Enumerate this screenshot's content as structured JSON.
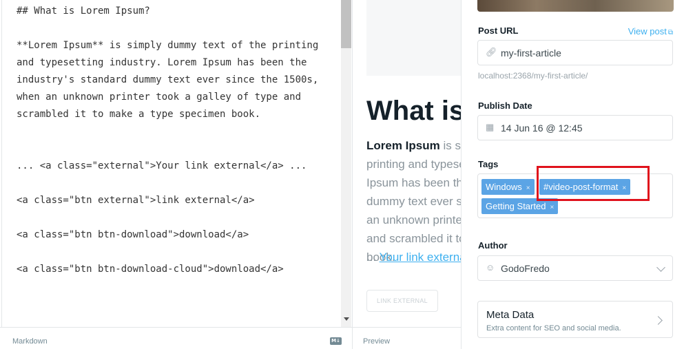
{
  "editor": {
    "lines": [
      "## What is Lorem Ipsum?",
      "",
      "**Lorem Ipsum** is simply dummy text of the printing and typesetting industry. Lorem Ipsum has been the industry's standard dummy text ever since the 1500s, when an unknown printer took a galley of type and scrambled it to make a type specimen book.",
      "",
      "",
      "... <a class=\"external\">Your link external</a> ...",
      "",
      "<a class=\"btn external\">link external</a>",
      "",
      "<a class=\"btn btn-download\">download</a>",
      "",
      "<a class=\"btn btn-download-cloud\">download</a>"
    ],
    "footer_label": "Markdown",
    "badge": "M↓"
  },
  "preview": {
    "heading": "What is Lorem Ipsum?",
    "para_bold": "Lorem Ipsum",
    "para_rest": " is simply dummy text of the printing and typesetting industry. Lorem Ipsum has been the industry's standard dummy text ever since the 1500s, when an unknown printer took a galley of type and scrambled it to make a type specimen book.",
    "link_prefix": "... ",
    "link_text": "Your link external",
    "button_text": "LINK EXTERNAL",
    "footer_label": "Preview"
  },
  "settings": {
    "post_url": {
      "label": "Post URL",
      "view_post": "View post",
      "value": "my-first-article",
      "hint": "localhost:2368/my-first-article/"
    },
    "publish_date": {
      "label": "Publish Date",
      "value": "14 Jun 16 @ 12:45"
    },
    "tags": {
      "label": "Tags",
      "items": [
        "Windows",
        "#video-post-format",
        "Getting Started"
      ],
      "remove_glyph": "×"
    },
    "author": {
      "label": "Author",
      "value": "GodoFredo"
    },
    "meta_data": {
      "title": "Meta Data",
      "subtitle": "Extra content for SEO and social media."
    }
  },
  "colors": {
    "accent": "#3eb0ef",
    "tag_bg": "#5ba4e5",
    "highlight": "#e0121c"
  }
}
